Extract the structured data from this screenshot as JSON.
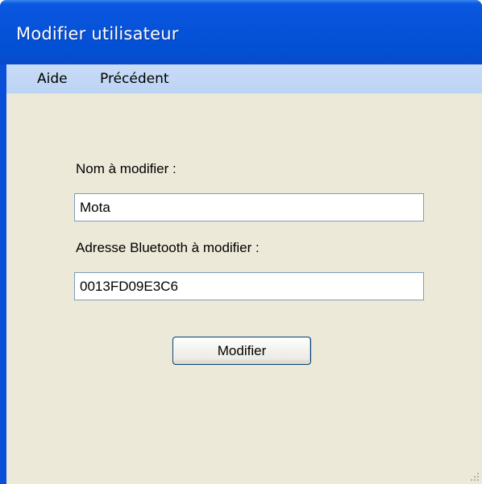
{
  "window": {
    "title": "Modifier utilisateur"
  },
  "menu": {
    "items": [
      {
        "label": "Aide"
      },
      {
        "label": "Précédent"
      }
    ]
  },
  "form": {
    "name_label": "Nom à modifier :",
    "name_value": "Mota",
    "bluetooth_label": "Adresse Bluetooth à modifier :",
    "bluetooth_value": "0013FD09E3C6",
    "submit_label": "Modifier"
  },
  "colors": {
    "titlebar": "#0552d8",
    "menubar": "#c3d8f6",
    "client": "#ece9d8"
  },
  "icons": [
    "resize-grip-icon"
  ]
}
